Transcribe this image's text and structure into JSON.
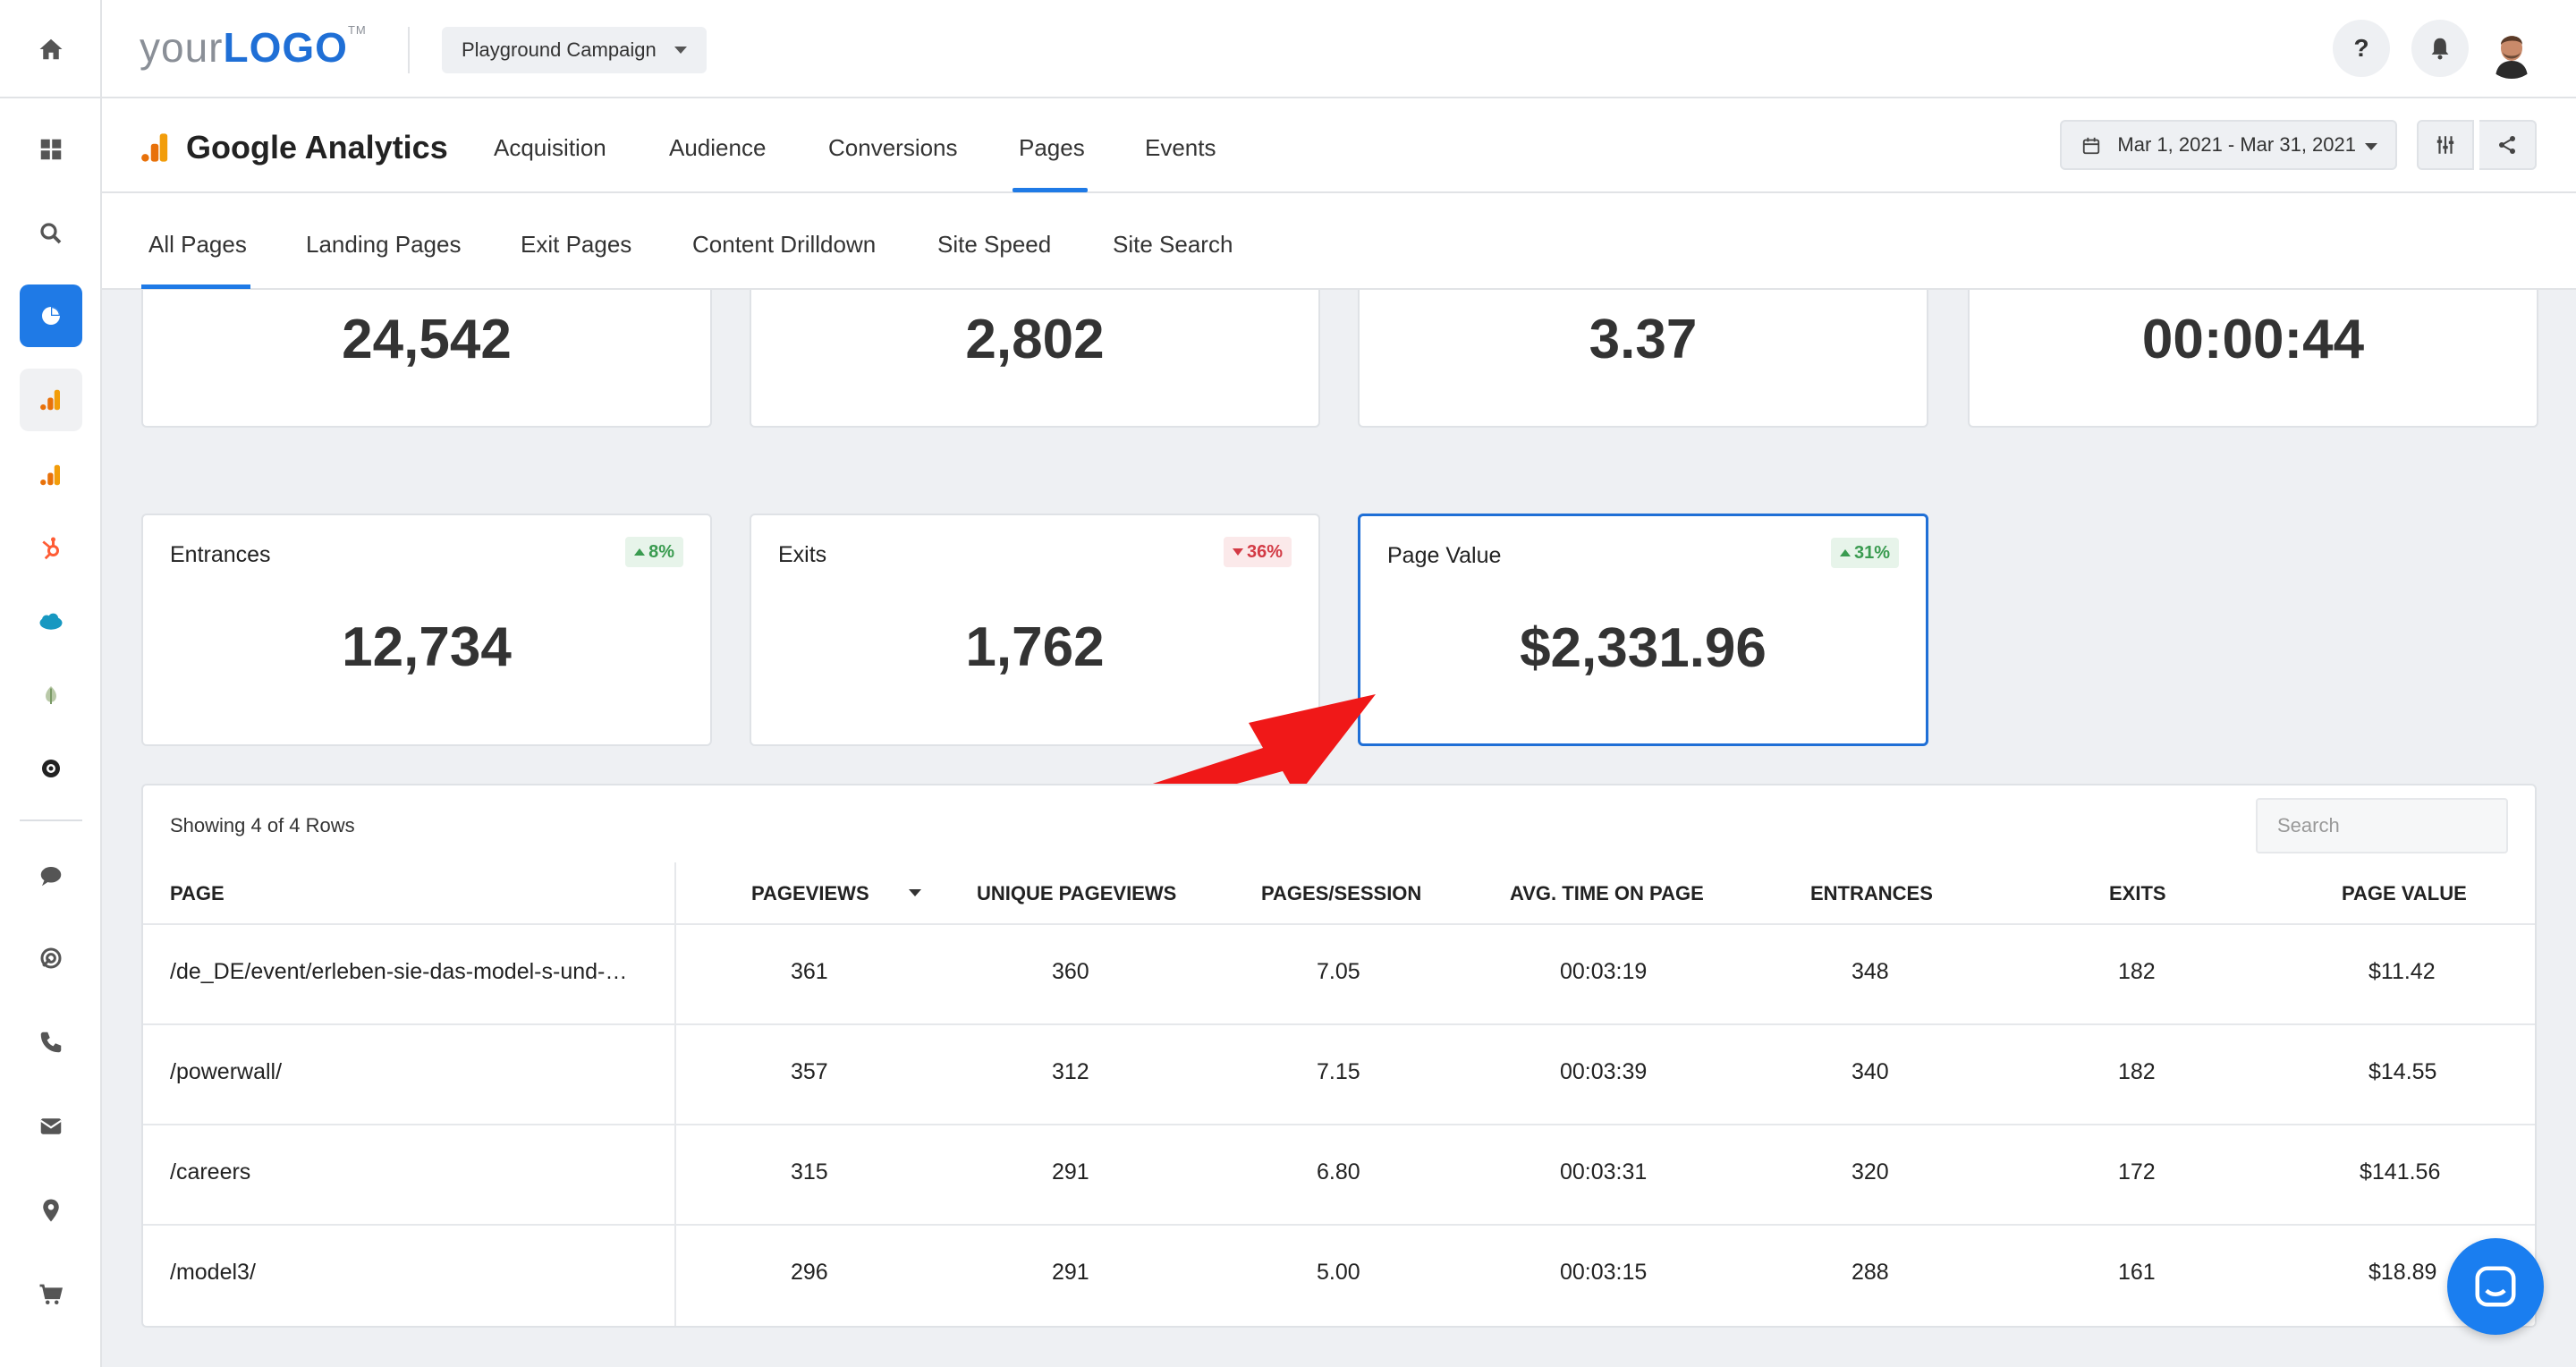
{
  "header": {
    "logo_your": "your",
    "logo_brand": "LOGO",
    "logo_tm": "TM",
    "campaign": "Playground Campaign",
    "help_label": "?"
  },
  "section": {
    "title": "Google Analytics",
    "tabs": [
      "Acquisition",
      "Audience",
      "Conversions",
      "Pages",
      "Events"
    ],
    "active_tab": "Pages",
    "date_range": "Mar 1, 2021 - Mar 31, 2021"
  },
  "subtabs": {
    "items": [
      "All Pages",
      "Landing Pages",
      "Exit Pages",
      "Content Drilldown",
      "Site Speed",
      "Site Search"
    ],
    "active": "All Pages"
  },
  "metrics_top": [
    {
      "value": "24,542"
    },
    {
      "value": "2,802"
    },
    {
      "value": "3.37"
    },
    {
      "value": "00:00:44"
    }
  ],
  "metrics_bottom": [
    {
      "label": "Entrances",
      "value": "12,734",
      "change": "8%",
      "direction": "up"
    },
    {
      "label": "Exits",
      "value": "1,762",
      "change": "36%",
      "direction": "down"
    },
    {
      "label": "Page Value",
      "value": "$2,331.96",
      "change": "31%",
      "direction": "up"
    }
  ],
  "table": {
    "showing": "Showing 4 of 4 Rows",
    "search_placeholder": "Search",
    "columns": [
      "PAGE",
      "PAGEVIEWS",
      "UNIQUE PAGEVIEWS",
      "PAGES/SESSION",
      "AVG. TIME ON PAGE",
      "ENTRANCES",
      "EXITS",
      "PAGE VALUE"
    ],
    "rows": [
      [
        "/de_DE/event/erleben-sie-das-model-s-und-…",
        "361",
        "360",
        "7.05",
        "00:03:19",
        "348",
        "182",
        "$11.42"
      ],
      [
        "/powerwall/",
        "357",
        "312",
        "7.15",
        "00:03:39",
        "340",
        "182",
        "$14.55"
      ],
      [
        "/careers",
        "315",
        "291",
        "6.80",
        "00:03:31",
        "320",
        "172",
        "$141.56"
      ],
      [
        "/model3/",
        "296",
        "291",
        "5.00",
        "00:03:15",
        "288",
        "161",
        "$18.89"
      ]
    ]
  },
  "colors": {
    "accent": "#1f7ae6",
    "up": "#3a9b50",
    "down": "#d33a45",
    "annotation_arrow": "#f01818"
  }
}
